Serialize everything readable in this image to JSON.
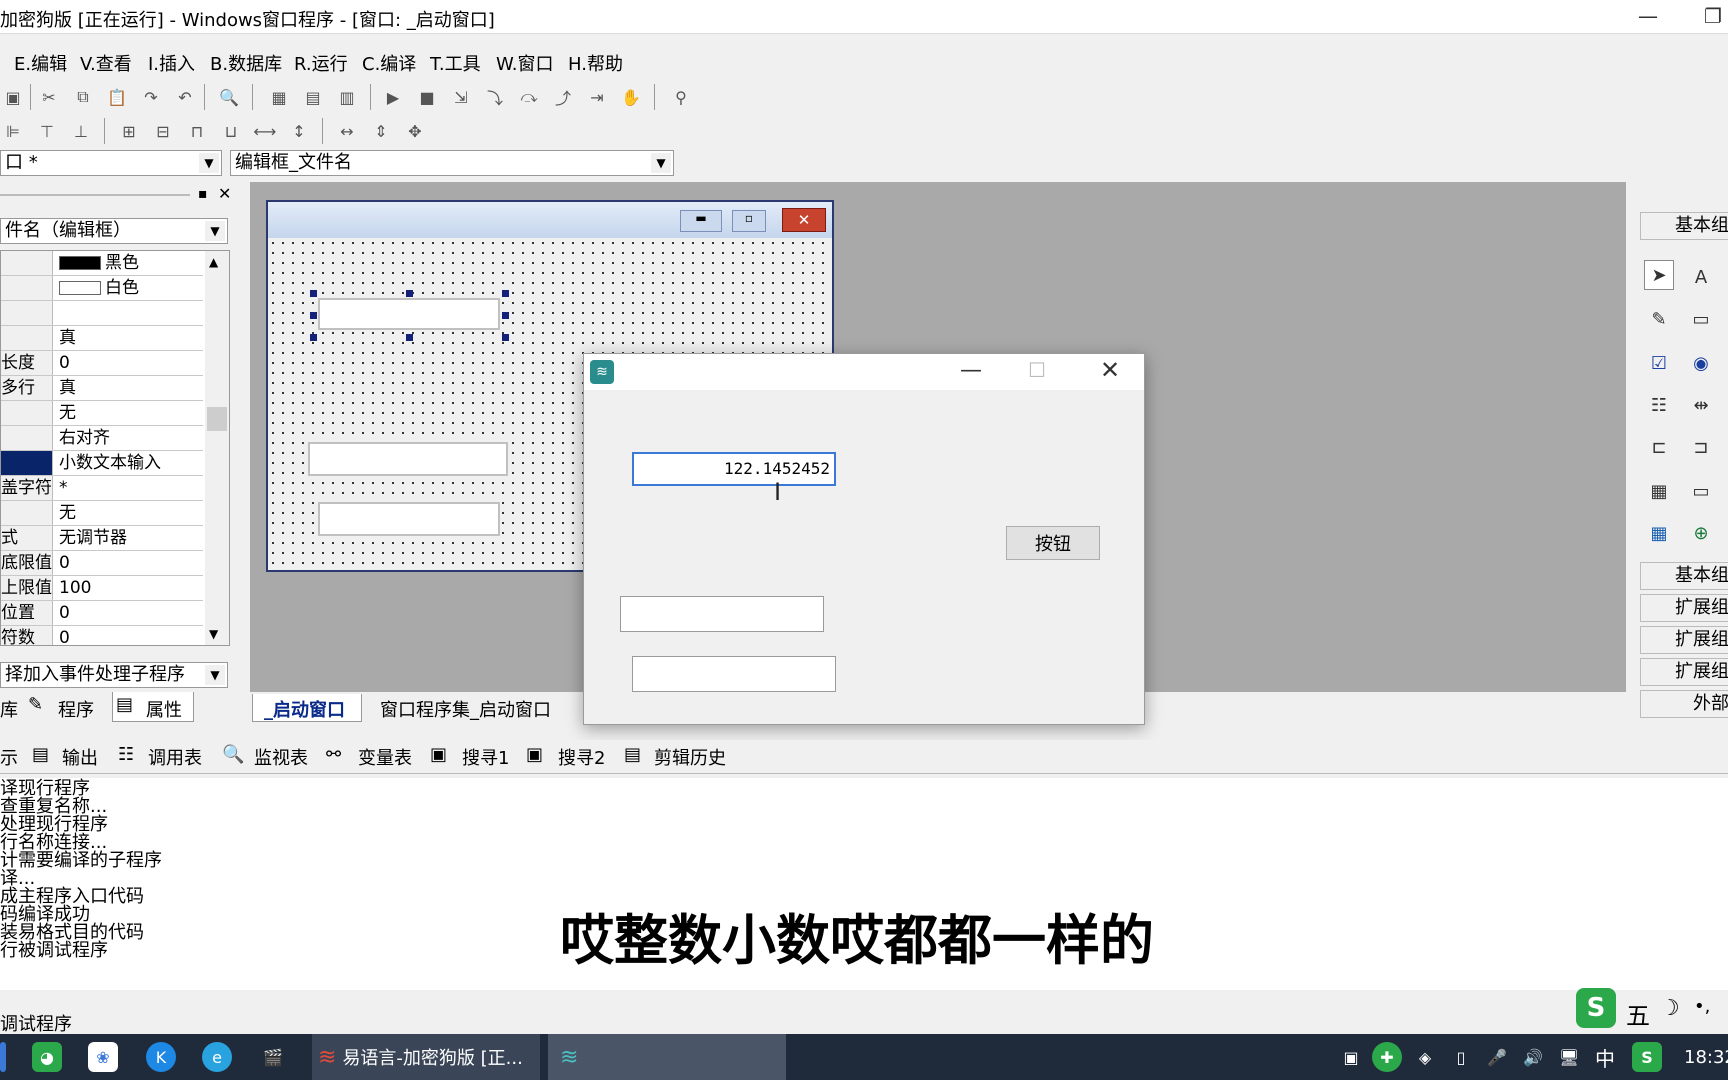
{
  "title_bar": {
    "title": "加密狗版 [正在运行] - Windows窗口程序 - [窗口: _启动窗口]",
    "min": "—",
    "restore": "❐"
  },
  "menu": [
    "E.编辑",
    "V.查看",
    "I.插入",
    "B.数据库",
    "R.运行",
    "C.编译",
    "T.工具",
    "W.窗口",
    "H.帮助"
  ],
  "combos": {
    "left_text": "口 *",
    "right_text": "编辑框_文件名"
  },
  "props": {
    "object_combo": "件名（编辑框）",
    "rows": [
      {
        "k": "",
        "v": "黑色"
      },
      {
        "k": "",
        "v": "白色"
      },
      {
        "k": "",
        "v": ""
      },
      {
        "k": "",
        "v": "真"
      },
      {
        "k": "长度",
        "v": "0"
      },
      {
        "k": "多行",
        "v": "真"
      },
      {
        "k": "",
        "v": "无"
      },
      {
        "k": "",
        "v": "右对齐"
      },
      {
        "k": "",
        "v": "小数文本输入"
      },
      {
        "k": "盖字符",
        "v": "*"
      },
      {
        "k": "",
        "v": "无"
      },
      {
        "k": "式",
        "v": "无调节器"
      },
      {
        "k": "底限值",
        "v": "0"
      },
      {
        "k": "上限值",
        "v": "100"
      },
      {
        "k": "位置",
        "v": "0"
      },
      {
        "k": "符数",
        "v": "0"
      }
    ],
    "event_combo": "择加入事件处理子程序",
    "tabs": [
      "库",
      "程序",
      "属性"
    ]
  },
  "design_tabs": [
    "_启动窗口",
    "窗口程序集_启动窗口"
  ],
  "run_window": {
    "input_value": "122.1452452",
    "button_label": "按钮"
  },
  "right_panel": {
    "tabs": [
      "基本组",
      "基本组",
      "扩展组",
      "扩展组",
      "扩展组",
      "外部"
    ]
  },
  "bottom_tabs": [
    "示",
    "输出",
    "调用表",
    "监视表",
    "变量表",
    "搜寻1",
    "搜寻2",
    "剪辑历史"
  ],
  "output_lines": [
    "译现行程序",
    "查重复名称...",
    "处理现行程序",
    "行名称连接...",
    "计需要编译的子程序",
    "译...",
    "成主程序入口代码",
    "码编译成功",
    "装易格式目的代码",
    "行被调试程序"
  ],
  "subtitle": "哎整数小数哎都都一样的",
  "status_text": "调试程序",
  "ime": {
    "label": "五"
  },
  "taskbar": {
    "app_label": "易语言-加密狗版 [正...",
    "tray_lang": "中",
    "clock": "18:32"
  }
}
